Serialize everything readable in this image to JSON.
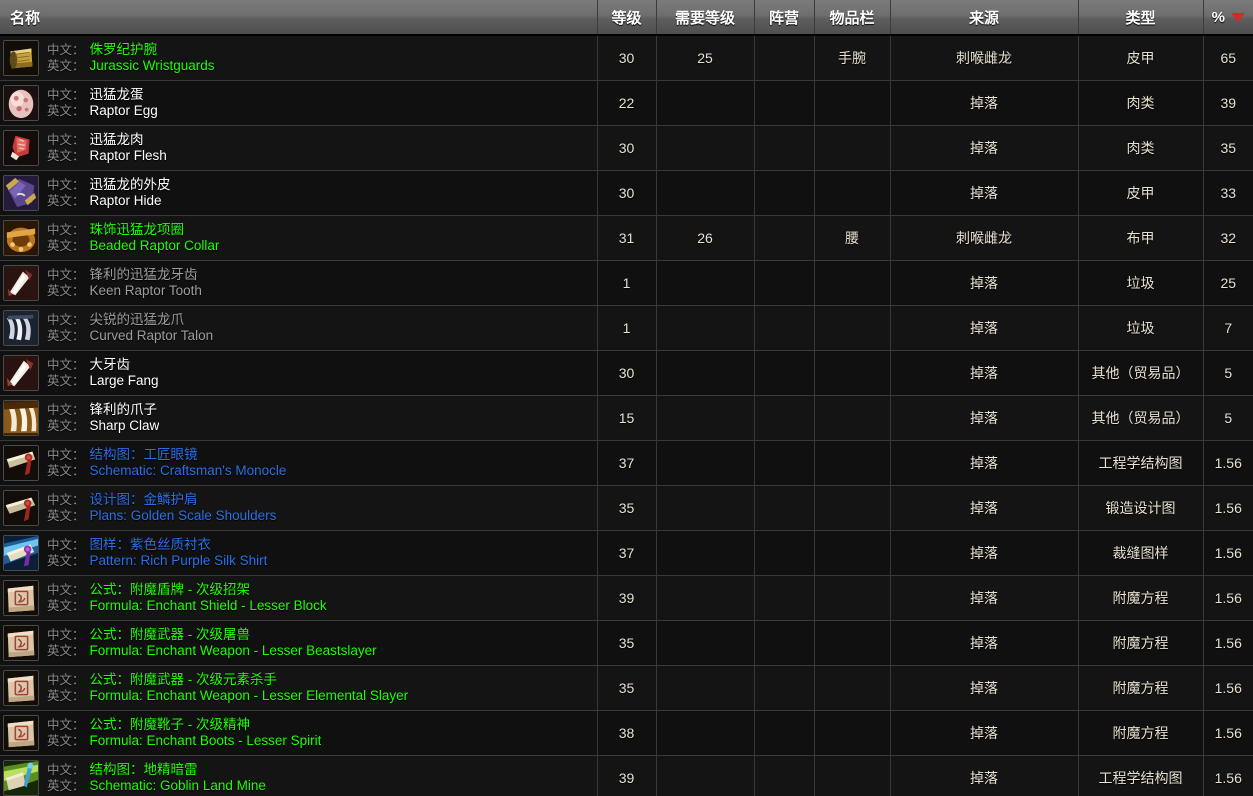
{
  "table": {
    "headers": {
      "name": "名称",
      "level": "等级",
      "req_level": "需要等级",
      "faction": "阵营",
      "slot": "物品栏",
      "source": "来源",
      "type": "类型",
      "percent": "%",
      "sort_icon": "sort-descending-arrow-icon"
    },
    "labels": {
      "chinese": "中文：",
      "english": "英文："
    },
    "rows": [
      {
        "icon": "bracer-gold-icon",
        "quality": "uncommon",
        "name_cn": "侏罗纪护腕",
        "name_en": "Jurassic Wristguards",
        "level": "30",
        "req_level": "25",
        "faction": "",
        "slot": "手腕",
        "source": "刺喉雌龙",
        "type": "皮甲",
        "percent": "65"
      },
      {
        "icon": "raptor-egg-icon",
        "quality": "common",
        "name_cn": "迅猛龙蛋",
        "name_en": "Raptor Egg",
        "level": "22",
        "req_level": "",
        "faction": "",
        "slot": "",
        "source": "掉落",
        "type": "肉类",
        "percent": "39"
      },
      {
        "icon": "raw-meat-icon",
        "quality": "common",
        "name_cn": "迅猛龙肉",
        "name_en": "Raptor Flesh",
        "level": "30",
        "req_level": "",
        "faction": "",
        "slot": "",
        "source": "掉落",
        "type": "肉类",
        "percent": "35"
      },
      {
        "icon": "raptor-hide-icon",
        "quality": "common",
        "name_cn": "迅猛龙的外皮",
        "name_en": "Raptor Hide",
        "level": "30",
        "req_level": "",
        "faction": "",
        "slot": "",
        "source": "掉落",
        "type": "皮甲",
        "percent": "33"
      },
      {
        "icon": "beaded-collar-icon",
        "quality": "uncommon",
        "name_cn": "珠饰迅猛龙项圈",
        "name_en": "Beaded Raptor Collar",
        "level": "31",
        "req_level": "26",
        "faction": "",
        "slot": "腰",
        "source": "刺喉雌龙",
        "type": "布甲",
        "percent": "32"
      },
      {
        "icon": "raptor-tooth-icon",
        "quality": "poor",
        "name_cn": "锋利的迅猛龙牙齿",
        "name_en": "Keen Raptor Tooth",
        "level": "1",
        "req_level": "",
        "faction": "",
        "slot": "",
        "source": "掉落",
        "type": "垃圾",
        "percent": "25"
      },
      {
        "icon": "raptor-talon-icon",
        "quality": "poor",
        "name_cn": "尖锐的迅猛龙爪",
        "name_en": "Curved Raptor Talon",
        "level": "1",
        "req_level": "",
        "faction": "",
        "slot": "",
        "source": "掉落",
        "type": "垃圾",
        "percent": "7"
      },
      {
        "icon": "large-fang-icon",
        "quality": "common",
        "name_cn": "大牙齿",
        "name_en": "Large Fang",
        "level": "30",
        "req_level": "",
        "faction": "",
        "slot": "",
        "source": "掉落",
        "type": "其他（贸易品）",
        "percent": "5"
      },
      {
        "icon": "sharp-claw-icon",
        "quality": "common",
        "name_cn": "锋利的爪子",
        "name_en": "Sharp Claw",
        "level": "15",
        "req_level": "",
        "faction": "",
        "slot": "",
        "source": "掉落",
        "type": "其他（贸易品）",
        "percent": "5"
      },
      {
        "icon": "schematic-scroll-red-icon",
        "quality": "rare",
        "name_cn": "结构图：工匠眼镜",
        "name_en": "Schematic: Craftsman's Monocle",
        "level": "37",
        "req_level": "",
        "faction": "",
        "slot": "",
        "source": "掉落",
        "type": "工程学结构图",
        "percent": "1.56"
      },
      {
        "icon": "plans-scroll-red-icon",
        "quality": "rare",
        "name_cn": "设计图：金鳞护肩",
        "name_en": "Plans: Golden Scale Shoulders",
        "level": "35",
        "req_level": "",
        "faction": "",
        "slot": "",
        "source": "掉落",
        "type": "锻造设计图",
        "percent": "1.56"
      },
      {
        "icon": "pattern-scroll-purple-icon",
        "quality": "rare",
        "name_cn": "图样：紫色丝质衬衣",
        "name_en": "Pattern: Rich Purple Silk Shirt",
        "level": "37",
        "req_level": "",
        "faction": "",
        "slot": "",
        "source": "掉落",
        "type": "裁缝图样",
        "percent": "1.56"
      },
      {
        "icon": "formula-parchment-icon",
        "quality": "uncommon",
        "name_cn": "公式：附魔盾牌 - 次级招架",
        "name_en": "Formula: Enchant Shield - Lesser Block",
        "level": "39",
        "req_level": "",
        "faction": "",
        "slot": "",
        "source": "掉落",
        "type": "附魔方程",
        "percent": "1.56"
      },
      {
        "icon": "formula-parchment-icon",
        "quality": "uncommon",
        "name_cn": "公式：附魔武器 - 次级屠兽",
        "name_en": "Formula: Enchant Weapon - Lesser Beastslayer",
        "level": "35",
        "req_level": "",
        "faction": "",
        "slot": "",
        "source": "掉落",
        "type": "附魔方程",
        "percent": "1.56"
      },
      {
        "icon": "formula-parchment-icon",
        "quality": "uncommon",
        "name_cn": "公式：附魔武器 - 次级元素杀手",
        "name_en": "Formula: Enchant Weapon - Lesser Elemental Slayer",
        "level": "35",
        "req_level": "",
        "faction": "",
        "slot": "",
        "source": "掉落",
        "type": "附魔方程",
        "percent": "1.56"
      },
      {
        "icon": "formula-parchment-icon",
        "quality": "uncommon",
        "name_cn": "公式：附魔靴子 - 次级精神",
        "name_en": "Formula: Enchant Boots - Lesser Spirit",
        "level": "38",
        "req_level": "",
        "faction": "",
        "slot": "",
        "source": "掉落",
        "type": "附魔方程",
        "percent": "1.56"
      },
      {
        "icon": "schematic-scroll-green-icon",
        "quality": "uncommon",
        "name_cn": "结构图：地精暗雷",
        "name_en": "Schematic: Goblin Land Mine",
        "level": "39",
        "req_level": "",
        "faction": "",
        "slot": "",
        "source": "掉落",
        "type": "工程学结构图",
        "percent": "1.56"
      }
    ]
  }
}
